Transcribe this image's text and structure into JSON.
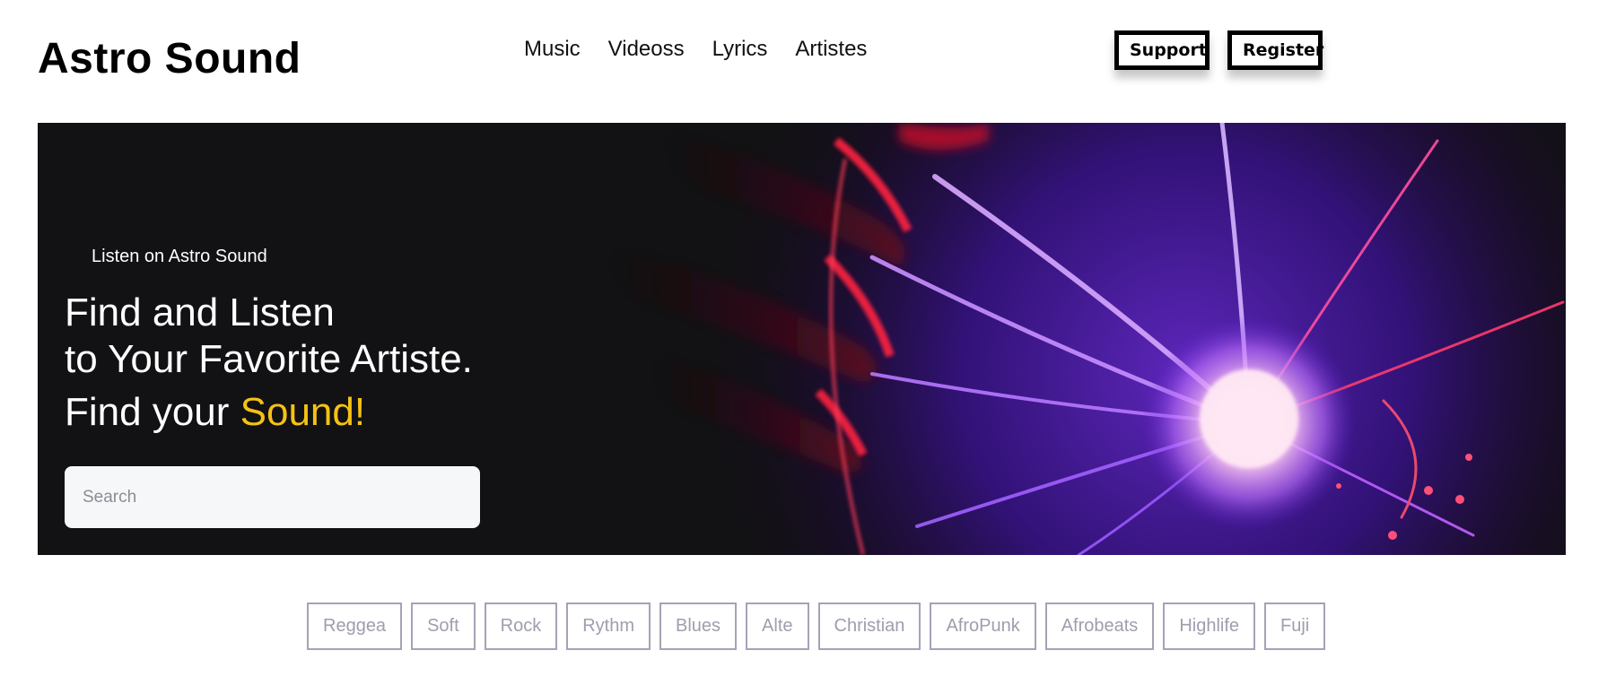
{
  "header": {
    "logo": "Astro Sound",
    "nav": [
      "Music",
      "Videoss",
      "Lyrics",
      "Artistes"
    ],
    "support_label": "Support",
    "register_label": "Register"
  },
  "hero": {
    "eyebrow": "Listen on Astro Sound",
    "headline_line1": "Find and Listen",
    "headline_line2": "to Your Favorite Artiste.",
    "tagline_prefix": "Find your ",
    "tagline_accent": "Sound!",
    "search_placeholder": "Search",
    "accent_color": "#f4c215"
  },
  "genres": [
    "Reggea",
    "Soft",
    "Rock",
    "Rythm",
    "Blues",
    "Alte",
    "Christian",
    "AfroPunk",
    "Afrobeats",
    "Highlife",
    "Fuji"
  ]
}
